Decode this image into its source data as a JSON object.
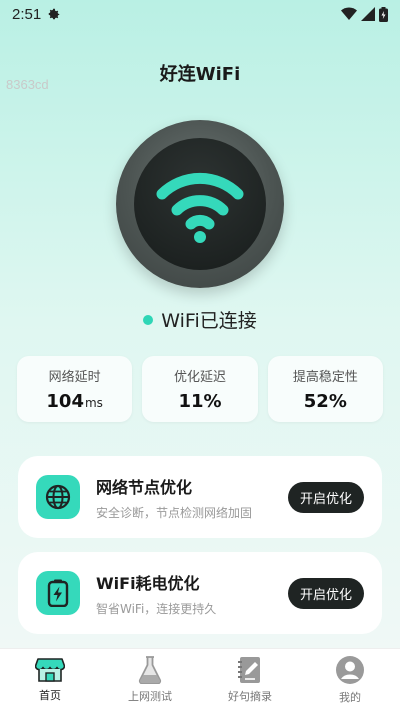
{
  "status_bar": {
    "time": "2:51"
  },
  "app": {
    "title": "好连WiFi",
    "hex_id": "8363cd"
  },
  "connection": {
    "status_text": "WiFi已连接"
  },
  "stats": [
    {
      "label": "网络延时",
      "value": "104",
      "unit": "ms"
    },
    {
      "label": "优化延迟",
      "value": "11%"
    },
    {
      "label": "提高稳定性",
      "value": "52%"
    }
  ],
  "features": [
    {
      "title": "网络节点优化",
      "subtitle": "安全诊断，节点检测网络加固",
      "button": "开启优化",
      "icon": "globe-icon"
    },
    {
      "title": "WiFi耗电优化",
      "subtitle": "智省WiFi，连接更持久",
      "button": "开启优化",
      "icon": "battery-bolt-icon"
    }
  ],
  "nav": [
    {
      "label": "首页",
      "icon": "store-icon",
      "active": true
    },
    {
      "label": "上网测试",
      "icon": "flask-icon"
    },
    {
      "label": "好句摘录",
      "icon": "notebook-pen-icon"
    },
    {
      "label": "我的",
      "icon": "user-icon"
    }
  ],
  "colors": {
    "accent": "#35d9bb",
    "button_dark": "#1f2423"
  }
}
